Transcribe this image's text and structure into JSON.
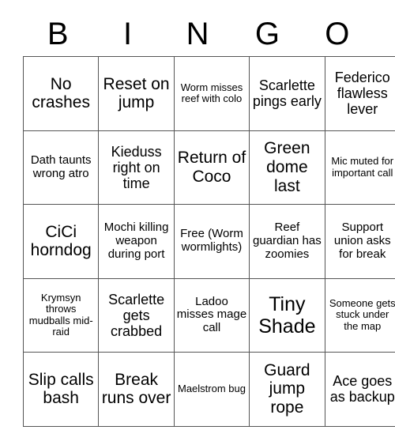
{
  "card": {
    "header_letters": [
      "B",
      "I",
      "N",
      "G",
      "O"
    ],
    "rows": [
      [
        {
          "text": "No crashes",
          "size": "fs-lg"
        },
        {
          "text": "Reset on jump",
          "size": "fs-lg"
        },
        {
          "text": "Worm misses reef with colo",
          "size": "fs-xs"
        },
        {
          "text": "Scarlette pings early",
          "size": "fs-md"
        },
        {
          "text": "Federico flawless lever",
          "size": "fs-md"
        }
      ],
      [
        {
          "text": "Dath taunts wrong atro",
          "size": "fs-sm"
        },
        {
          "text": "Kieduss right on time",
          "size": "fs-md"
        },
        {
          "text": "Return of Coco",
          "size": "fs-lg"
        },
        {
          "text": "Green dome last",
          "size": "fs-lg"
        },
        {
          "text": "Mic muted for important call",
          "size": "fs-xs"
        }
      ],
      [
        {
          "text": "CiCi horndog",
          "size": "fs-lg"
        },
        {
          "text": "Mochi killing weapon during port",
          "size": "fs-sm"
        },
        {
          "text": "Free (Worm wormlights)",
          "size": "fs-sm"
        },
        {
          "text": "Reef guardian has zoomies",
          "size": "fs-sm"
        },
        {
          "text": "Support union asks for break",
          "size": "fs-sm"
        }
      ],
      [
        {
          "text": "Krymsyn throws mudballs mid-raid",
          "size": "fs-xs"
        },
        {
          "text": "Scarlette gets crabbed",
          "size": "fs-md"
        },
        {
          "text": "Ladoo misses mage call",
          "size": "fs-sm"
        },
        {
          "text": "Tiny Shade",
          "size": "fs-xl"
        },
        {
          "text": "Someone gets stuck under the map",
          "size": "fs-xs"
        }
      ],
      [
        {
          "text": "Slip calls bash",
          "size": "fs-lg"
        },
        {
          "text": "Break runs over",
          "size": "fs-lg"
        },
        {
          "text": "Maelstrom bug",
          "size": "fs-xs"
        },
        {
          "text": "Guard jump rope",
          "size": "fs-lg"
        },
        {
          "text": "Ace goes as backup",
          "size": "fs-md"
        }
      ]
    ]
  },
  "colors": {
    "background": "#ffffff",
    "text": "#000000",
    "grid_line": "#555555"
  }
}
